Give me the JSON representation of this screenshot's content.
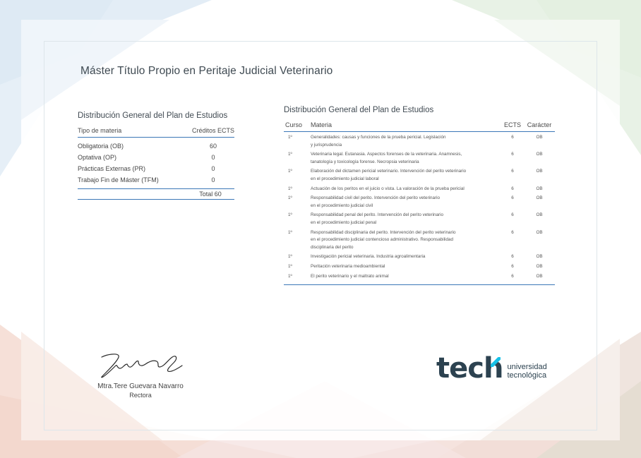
{
  "colors": {
    "accent": "#3b77b7",
    "logo_cyan": "#16c1e8",
    "text": "#3f4a52"
  },
  "title": "Máster Título Propio en Peritaje Judicial Veterinario",
  "summary": {
    "title": "Distribución General del Plan de Estudios",
    "header": {
      "type": "Tipo de materia",
      "credits": "Créditos ECTS"
    },
    "rows": [
      {
        "type": "Obligatoria (OB)",
        "credits": "60"
      },
      {
        "type": "Optativa (OP)",
        "credits": "0"
      },
      {
        "type": "Prácticas Externas (PR)",
        "credits": "0"
      },
      {
        "type": "Trabajo Fin de Máster (TFM)",
        "credits": "0"
      }
    ],
    "total": "Total 60"
  },
  "detail": {
    "title": "Distribución General del Plan de Estudios",
    "header": {
      "curso": "Curso",
      "materia": "Materia",
      "ects": "ECTS",
      "caracter": "Carácter"
    },
    "rows": [
      {
        "curso": "1º",
        "materia": [
          "Generalidades: causas y funciones de la prueba pericial. Legislación",
          "y jurisprudencia"
        ],
        "ects": "6",
        "caracter": "OB"
      },
      {
        "curso": "1º",
        "materia": [
          "Veterinaria legal. Eutanasia. Aspectos forenses de la veterinaria. Anamnesis,",
          "tanatología y toxicología forense. Necropsia veterinaria"
        ],
        "ects": "6",
        "caracter": "OB"
      },
      {
        "curso": "1º",
        "materia": [
          "Elaboración del dictamen pericial veterinario. Intervención del perito veterinario",
          "en el procedimiento judicial laboral"
        ],
        "ects": "6",
        "caracter": "OB"
      },
      {
        "curso": "1º",
        "materia": [
          "Actuación de los peritos en el juicio o vista. La valoración de la prueba pericial"
        ],
        "ects": "6",
        "caracter": "OB"
      },
      {
        "curso": "1º",
        "materia": [
          "Responsabilidad civil del perito. Intervención del perito veterinario",
          "en el procedimiento judicial civil"
        ],
        "ects": "6",
        "caracter": "OB"
      },
      {
        "curso": "1º",
        "materia": [
          "Responsabilidad penal del perito. Intervención del perito veterinario",
          "en el procedimiento judicial penal"
        ],
        "ects": "6",
        "caracter": "OB"
      },
      {
        "curso": "1º",
        "materia": [
          "Responsabilidad disciplinaria del perito. Intervención del perito veterinario",
          "en el procedimiento judicial contencioso administrativo. Responsabilidad",
          "disciplinaria del perito"
        ],
        "ects": "6",
        "caracter": "OB"
      },
      {
        "curso": "1º",
        "materia": [
          "Investigación pericial veterinaria. Industria agroalimentaria"
        ],
        "ects": "6",
        "caracter": "OB"
      },
      {
        "curso": "1º",
        "materia": [
          "Peritación veterinaria medioambiental"
        ],
        "ects": "6",
        "caracter": "OB"
      },
      {
        "curso": "1º",
        "materia": [
          "El perito veterinario y el maltrato animal"
        ],
        "ects": "6",
        "caracter": "OB"
      }
    ]
  },
  "signature": {
    "name": "Mtra.Tere Guevara Navarro",
    "role": "Rectora"
  },
  "logo": {
    "wordmark_prefix": "tec",
    "wordmark_suffix": "h",
    "line1": "universidad",
    "line2": "tecnológica"
  }
}
